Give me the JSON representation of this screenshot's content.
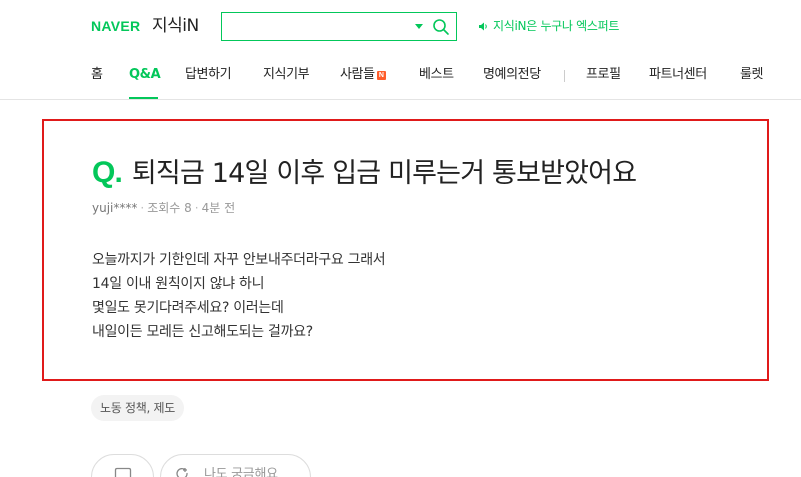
{
  "header": {
    "logo_naver": "NAVER",
    "logo_service": "지식iN",
    "search": {
      "value": "",
      "placeholder": ""
    },
    "expert_link": "지식iN은 누구나 엑스퍼트"
  },
  "nav": {
    "items": [
      {
        "label": "홈"
      },
      {
        "label": "Q&A",
        "active": true
      },
      {
        "label": "답변하기"
      },
      {
        "label": "지식기부"
      },
      {
        "label": "사람들",
        "badge": "N"
      },
      {
        "label": "베스트"
      },
      {
        "label": "명예의전당"
      },
      {
        "label": "프로필"
      },
      {
        "label": "파트너센터"
      },
      {
        "label": "룰렛"
      }
    ]
  },
  "question": {
    "mark": "Q.",
    "title": "퇴직금 14일 이후 입금 미루는거 통보받았어요",
    "author": "yuji****",
    "views": "조회수 8",
    "time": "4분 전",
    "body": [
      "오늘까지가 기한인데 자꾸 안보내주더라구요 그래서",
      "14일 이내 원칙이지 않냐 하니",
      "몇일도 못기다려주세요? 이러는데",
      "내일이든 모레든 신고해도되는 걸까요?"
    ]
  },
  "tag": "노동 정책, 제도",
  "actions": {
    "curious_label": "나도 궁금해요"
  },
  "colors": {
    "brand": "#03c75a",
    "highlight_border": "#e01a1a",
    "new_badge": "#ff5d2b"
  }
}
